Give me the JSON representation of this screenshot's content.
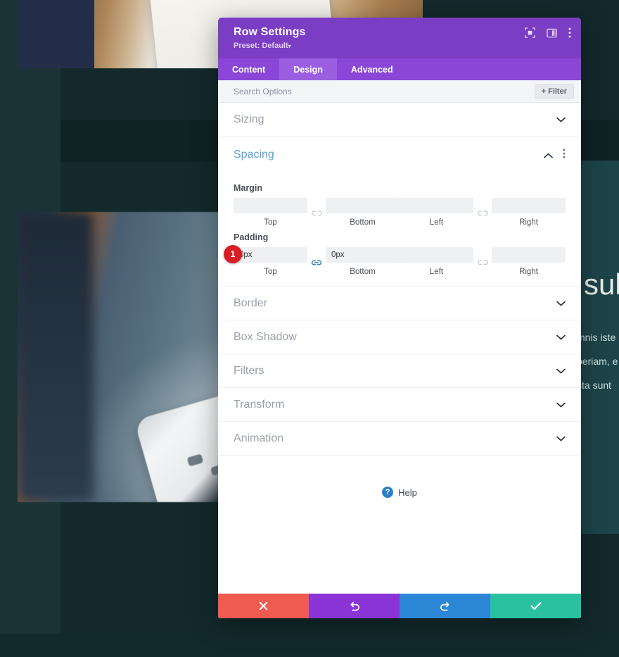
{
  "background": {
    "heading_fragment": "subt",
    "body_lines": [
      "mnis iste",
      "periam, e",
      "cta sunt "
    ],
    "images": [
      {
        "name": "notebook-on-desk-photo"
      },
      {
        "name": "hand-holding-phone-photo"
      }
    ],
    "colors": {
      "page_bg": "#13292b",
      "band_left": "#1b3336",
      "right_panel": "#1d4449"
    }
  },
  "modal": {
    "title": "Row Settings",
    "preset_label": "Preset: Default",
    "preset_caret": "▾",
    "header_icons": [
      {
        "name": "focus-icon"
      },
      {
        "name": "layout-panel-icon"
      },
      {
        "name": "more-vertical-icon"
      }
    ],
    "tabs": [
      {
        "label": "Content",
        "active": false
      },
      {
        "label": "Design",
        "active": true
      },
      {
        "label": "Advanced",
        "active": false
      }
    ],
    "search": {
      "value": "",
      "placeholder": "Search Options"
    },
    "filter_button": "+ Filter",
    "sections": [
      {
        "label": "Sizing",
        "state": "collapsed",
        "chevron": "⌄"
      },
      {
        "label": "Spacing",
        "state": "expanded",
        "chevron": "⌃"
      },
      {
        "label": "Border",
        "state": "collapsed",
        "chevron": "⌄"
      },
      {
        "label": "Box Shadow",
        "state": "collapsed",
        "chevron": "⌄"
      },
      {
        "label": "Filters",
        "state": "collapsed",
        "chevron": "⌄"
      },
      {
        "label": "Transform",
        "state": "collapsed",
        "chevron": "⌄"
      },
      {
        "label": "Animation",
        "state": "collapsed",
        "chevron": "⌄"
      }
    ],
    "spacing": {
      "margin": {
        "title": "Margin",
        "top": {
          "value": "",
          "caption": "Top"
        },
        "bottom": {
          "value": "",
          "caption": "Bottom"
        },
        "left": {
          "value": "",
          "caption": "Left"
        },
        "right": {
          "value": "",
          "caption": "Right"
        },
        "link_tb_state": "unlinked",
        "link_lr_state": "unlinked"
      },
      "padding": {
        "title": "Padding",
        "badge": "1",
        "top": {
          "value": "0px",
          "caption": "Top"
        },
        "bottom": {
          "value": "0px",
          "caption": "Bottom"
        },
        "left": {
          "value": "",
          "caption": "Left"
        },
        "right": {
          "value": "",
          "caption": "Right"
        },
        "link_tb_state": "linked",
        "link_lr_state": "unlinked"
      }
    },
    "help": {
      "label": "Help",
      "icon": "?"
    },
    "footer_buttons": [
      {
        "name": "cancel-button",
        "icon": "✖",
        "color": "#ef5a51"
      },
      {
        "name": "undo-button",
        "icon": "↺",
        "color": "#8b34d6"
      },
      {
        "name": "redo-button",
        "icon": "↻",
        "color": "#2b86d6"
      },
      {
        "name": "save-button",
        "icon": "✔",
        "color": "#2ac1a0"
      }
    ]
  }
}
